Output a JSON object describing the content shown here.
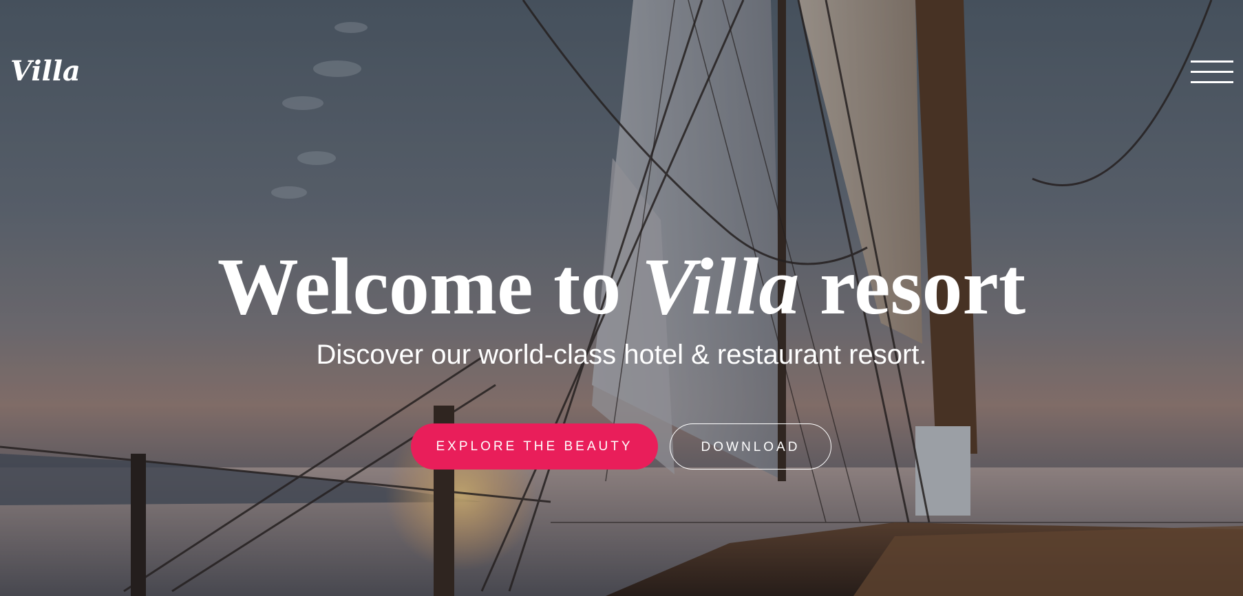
{
  "header": {
    "logo_text": "Villa",
    "menu_icon": "hamburger-menu-icon"
  },
  "hero": {
    "headline_before": "Welcome to",
    "headline_emphasis": "Villa",
    "headline_after": "resort",
    "subtitle": "Discover our world-class hotel & restaurant resort.",
    "primary_button_label": "Explore the beauty",
    "secondary_button_label": "Download",
    "background_image": "sailboat-deck-at-sunset"
  },
  "colors": {
    "accent": "#e91e5a",
    "text": "#ffffff"
  }
}
